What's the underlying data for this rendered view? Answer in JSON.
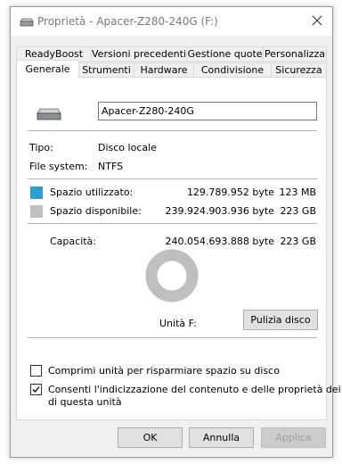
{
  "window": {
    "title": "Proprietà - Apacer-Z280-240G (F:)",
    "close_glyph": "✕"
  },
  "tabs_row1": [
    "ReadyBoost",
    "Versioni precedenti",
    "Gestione quote",
    "Personalizza"
  ],
  "tabs_row2": [
    "Generale",
    "Strumenti",
    "Hardware",
    "Condivisione",
    "Sicurezza"
  ],
  "active_tab": "Generale",
  "general": {
    "drive_name": "Apacer-Z280-240G",
    "type_label": "Tipo:",
    "type_value": "Disco locale",
    "fs_label": "File system:",
    "fs_value": "NTFS",
    "used_label": "Spazio utilizzato:",
    "used_bytes": "129.789.952 byte",
    "used_size": "123 MB",
    "free_label": "Spazio disponibile:",
    "free_bytes": "239.924.903.936 byte",
    "free_size": "223 GB",
    "capacity_label": "Capacità:",
    "capacity_bytes": "240.054.693.888 byte",
    "capacity_size": "223 GB",
    "drive_label": "Unità F:",
    "cleanup_button": "Pulizia disco",
    "used_color": "#26a0da",
    "free_color": "#bfbfbf",
    "used_fraction": 0.00054
  },
  "options": {
    "compress_label": "Comprimi unità per risparmiare spazio su disco",
    "compress_checked": false,
    "index_label_line1": "Consenti l'indicizzazione del contenuto e delle proprietà dei file",
    "index_label_line2": "di questa unità",
    "index_checked": true
  },
  "buttons": {
    "ok": "OK",
    "cancel": "Annulla",
    "apply": "Applica"
  },
  "icons": {
    "title_icon": "drive-icon",
    "drive_icon": "drive-icon",
    "close_icon": "close-icon",
    "check_icon": "checkmark-icon"
  }
}
